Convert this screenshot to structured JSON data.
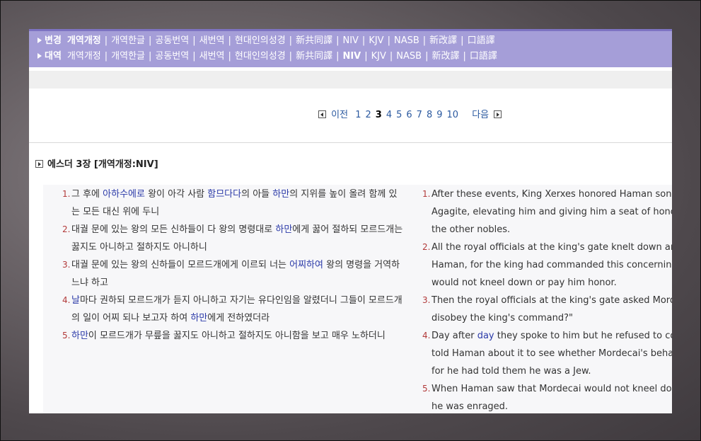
{
  "version_bar": {
    "rows": [
      {
        "label": "변경",
        "versions": [
          {
            "name": "개역개정",
            "active": true
          },
          {
            "name": "개역한글",
            "active": false
          },
          {
            "name": "공동번역",
            "active": false
          },
          {
            "name": "새번역",
            "active": false
          },
          {
            "name": "현대인의성경",
            "active": false
          },
          {
            "name": "新共同譯",
            "active": false
          },
          {
            "name": "NIV",
            "active": false
          },
          {
            "name": "KJV",
            "active": false
          },
          {
            "name": "NASB",
            "active": false
          },
          {
            "name": "新改譯",
            "active": false
          },
          {
            "name": "口語譯",
            "active": false
          }
        ]
      },
      {
        "label": "대역",
        "versions": [
          {
            "name": "개역개정",
            "active": false
          },
          {
            "name": "개역한글",
            "active": false
          },
          {
            "name": "공동번역",
            "active": false
          },
          {
            "name": "새번역",
            "active": false
          },
          {
            "name": "현대인의성경",
            "active": false
          },
          {
            "name": "新共同譯",
            "active": false
          },
          {
            "name": "NIV",
            "active": true
          },
          {
            "name": "KJV",
            "active": false
          },
          {
            "name": "NASB",
            "active": false
          },
          {
            "name": "新改譯",
            "active": false
          },
          {
            "name": "口語譯",
            "active": false
          }
        ]
      }
    ]
  },
  "pager": {
    "prev_label": "이전",
    "next_label": "다음",
    "pages": [
      "1",
      "2",
      "3",
      "4",
      "5",
      "6",
      "7",
      "8",
      "9",
      "10"
    ],
    "current": "3"
  },
  "chapter": {
    "title": "에스더 3장 [개역개정:NIV]"
  },
  "korean_verses": [
    {
      "num": "1.",
      "parts": [
        {
          "t": "그 후에 "
        },
        {
          "t": "아하수에로",
          "hl": true
        },
        {
          "t": " 왕이 아각 사람 "
        },
        {
          "t": "함므다다",
          "hl": true
        },
        {
          "t": "의 아들 "
        },
        {
          "t": "하만",
          "hl": true
        },
        {
          "t": "의 지위를 높이 올려 함께 있는 모든 대신 위에 두니"
        }
      ]
    },
    {
      "num": "2.",
      "parts": [
        {
          "t": "대궐 문에 있는 왕의 모든 신하들이 다 왕의 명령대로 "
        },
        {
          "t": "하만",
          "hl": true
        },
        {
          "t": "에게 꿇어 절하되 모르드개는 꿇지도 아니하고 절하지도 아니하니"
        }
      ]
    },
    {
      "num": "3.",
      "parts": [
        {
          "t": "대궐 문에 있는 왕의 신하들이 모르드개에게 이르되 너는 "
        },
        {
          "t": "어찌하여",
          "hl": true
        },
        {
          "t": " 왕의 명령을 거역하느냐 하고"
        }
      ]
    },
    {
      "num": "4.",
      "parts": [
        {
          "t": "날",
          "hl": true
        },
        {
          "t": "마다 권하되 모르드개가 듣지 아니하고 자기는 유다인임을 알렸더니 그들이 모르드개의 일이 어찌 되나 보고자 하여 "
        },
        {
          "t": "하만",
          "hl": true
        },
        {
          "t": "에게 전하였더라"
        }
      ]
    },
    {
      "num": "5.",
      "parts": [
        {
          "t": "하만",
          "hl": true
        },
        {
          "t": "이 모르드개가 무릎을 꿇지도 아니하고 절하지도 아니함을 보고 매우 노하더니"
        }
      ]
    }
  ],
  "english_verses": [
    {
      "num": "1.",
      "lines": [
        [
          {
            "t": "After these events, King Xerxes honored Haman son of "
          }
        ],
        [
          {
            "t": "Agagite, elevating him and giving him a seat of honor h"
          }
        ],
        [
          {
            "t": "the other nobles."
          }
        ]
      ]
    },
    {
      "num": "2.",
      "lines": [
        [
          {
            "t": "All the royal officials at the king's gate knelt down and "
          }
        ],
        [
          {
            "t": "Haman, for the king had commanded this concerning h"
          }
        ],
        [
          {
            "t": "would not kneel down or pay him honor."
          }
        ]
      ]
    },
    {
      "num": "3.",
      "lines": [
        [
          {
            "t": "Then the royal officials at the king's gate asked Mordeca"
          }
        ],
        [
          {
            "t": "disobey the king's command?\""
          }
        ]
      ]
    },
    {
      "num": "4.",
      "lines": [
        [
          {
            "t": "Day after "
          },
          {
            "t": "day",
            "hl": true
          },
          {
            "t": " they spoke to him but he refused to com"
          }
        ],
        [
          {
            "t": "told Haman about it to see whether Mordecai's behavio"
          }
        ],
        [
          {
            "t": "for he had told them he was a Jew."
          }
        ]
      ]
    },
    {
      "num": "5.",
      "lines": [
        [
          {
            "t": "When Haman saw that Mordecai would not kneel down"
          }
        ],
        [
          {
            "t": "he was enraged."
          }
        ]
      ]
    }
  ],
  "colors": {
    "version_bar_bg": "#a59ed8",
    "version_bar_top": "#7d73c2",
    "link_blue": "#2c5aa0",
    "highlight": "#2b3aa8",
    "verse_number": "#b23a3a",
    "content_bg": "#f7f7f9"
  }
}
